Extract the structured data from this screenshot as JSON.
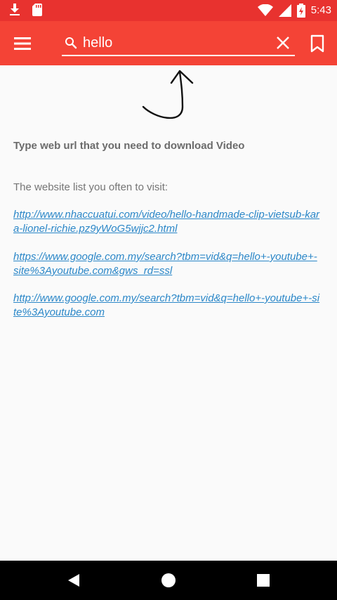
{
  "status_bar": {
    "time": "5:43",
    "icons": [
      "download-icon",
      "sd-card-icon",
      "wifi-icon",
      "signal-icon",
      "battery-icon"
    ]
  },
  "toolbar": {
    "search_value": "hello",
    "icons": [
      "menu-icon",
      "search-icon",
      "close-icon",
      "bookmark-icon"
    ]
  },
  "content": {
    "prompt": "Type web url that you need to download Video",
    "list_title": "The website list you often to visit:",
    "links": [
      "http://www.nhaccuatui.com/video/hello-handmade-clip-vietsub-kara-lionel-richie.pz9yWoG5wjjc2.html",
      "https://www.google.com.my/search?tbm=vid&q=hello+-youtube+-site%3Ayoutube.com&gws_rd=ssl",
      "http://www.google.com.my/search?tbm=vid&q=hello+-youtube+-site%3Ayoutube.com"
    ]
  },
  "colors": {
    "toolbar": "#f44336",
    "status_bar": "#e8322f",
    "link": "#2b87c8"
  }
}
